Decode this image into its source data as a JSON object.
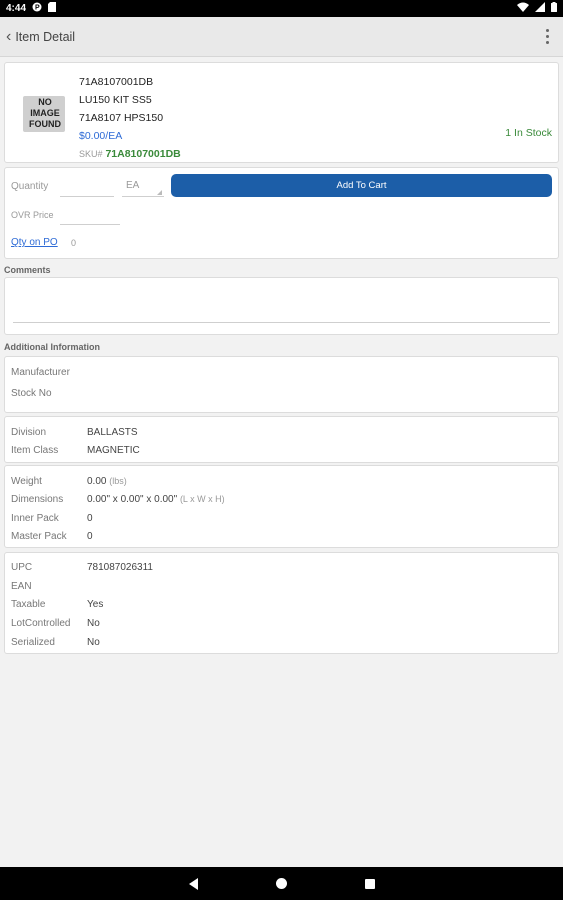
{
  "status_bar": {
    "time": "4:44"
  },
  "toolbar": {
    "back_label": "Item Detail"
  },
  "item": {
    "image_placeholder": "NO IMAGE FOUND",
    "part_number": "71A8107001DB",
    "description1": "LU150 KIT SS5",
    "description2": "71A8107 HPS150",
    "price": "$0.00/EA",
    "sku_label": "SKU#",
    "sku_value": "71A8107001DB",
    "stock": "1 In Stock"
  },
  "order": {
    "quantity_label": "Quantity",
    "uom": "EA",
    "add_to_cart_label": "Add To Cart",
    "ovr_price_label": "OVR Price",
    "qty_on_po_label": "Qty on PO",
    "qty_on_po_value": "0"
  },
  "comments": {
    "title": "Comments"
  },
  "additional": {
    "title": "Additional Information",
    "manufacturer_label": "Manufacturer",
    "stock_no_label": "Stock No",
    "division_label": "Division",
    "division_value": "BALLASTS",
    "item_class_label": "Item Class",
    "item_class_value": "MAGNETIC",
    "weight_label": "Weight",
    "weight_value": "0.00",
    "weight_unit": "(lbs)",
    "dimensions_label": "Dimensions",
    "dimensions_value": "0.00\" x 0.00\" x 0.00\"",
    "dimensions_unit": "(L x W x H)",
    "inner_pack_label": "Inner Pack",
    "inner_pack_value": "0",
    "master_pack_label": "Master Pack",
    "master_pack_value": "0",
    "upc_label": "UPC",
    "upc_value": "781087026311",
    "ean_label": "EAN",
    "taxable_label": "Taxable",
    "taxable_value": "Yes",
    "lot_label": "LotControlled",
    "lot_value": "No",
    "serialized_label": "Serialized",
    "serialized_value": "No"
  }
}
